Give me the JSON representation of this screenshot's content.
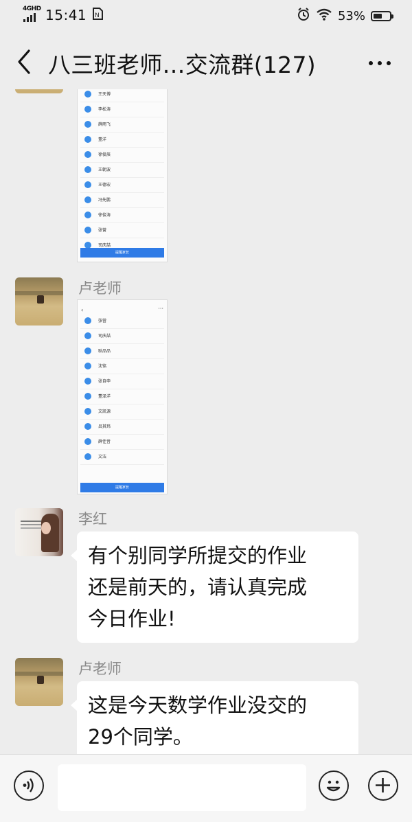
{
  "status_bar": {
    "network": "4GHD",
    "time": "15:41",
    "notification_icon": "sim-card-icon",
    "battery": "53%",
    "battery_level": 0.53
  },
  "header": {
    "back_icon": "back-arrow-icon",
    "title": "八三班老师…交流群(127)",
    "more_icon": "more-icon"
  },
  "messages": [
    {
      "type": "image",
      "sender": "",
      "names": [
        "王天博",
        "李松涛",
        "薛雨飞",
        "董洋",
        "徐俊辰",
        "王朝波",
        "王德宏",
        "冯先鹏",
        "徐俊涛",
        "张营",
        "司庆喆"
      ],
      "button": "提醒家长"
    },
    {
      "type": "image",
      "sender": "卢老师",
      "names": [
        "张营",
        "司庆喆",
        "耿品品",
        "沈铭",
        "张自申",
        "董泽洋",
        "文凯源",
        "吕其玮",
        "薛佳音",
        "文洁"
      ],
      "button": "提醒家长"
    },
    {
      "type": "text",
      "sender": "李红",
      "lines": [
        "有个别同学所提交的作业",
        "还是前天的，请认真完成",
        "今日作业!"
      ]
    },
    {
      "type": "text",
      "sender": "卢老师",
      "lines": [
        "这是今天数学作业没交的",
        "29个同学。"
      ]
    }
  ],
  "input_bar": {
    "voice_icon": "voice-icon",
    "placeholder": "",
    "emoji_icon": "emoji-icon",
    "plus_icon": "plus-icon"
  }
}
